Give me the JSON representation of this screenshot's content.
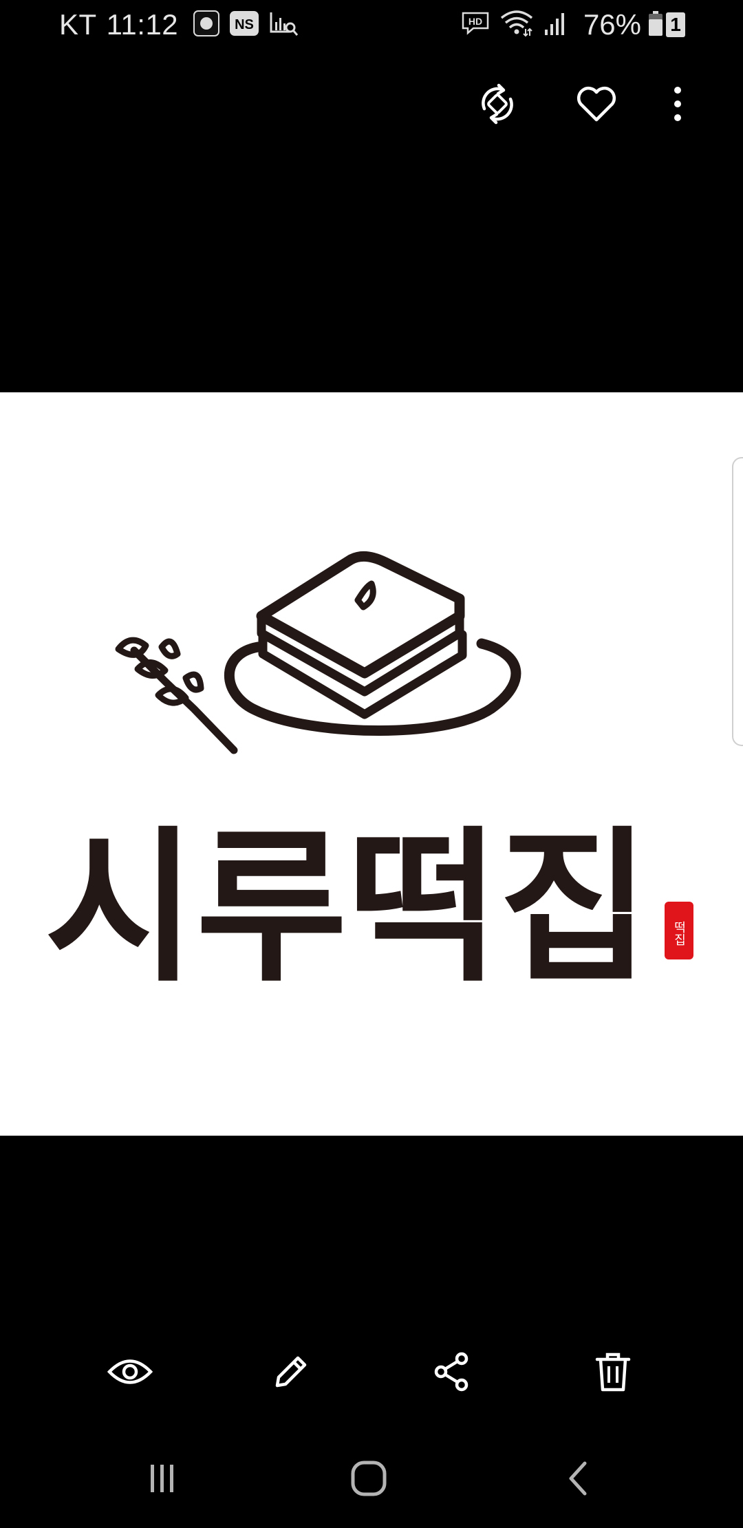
{
  "status_bar": {
    "carrier": "KT",
    "time": "11:12",
    "left_icons": [
      "record-icon",
      "ns-icon",
      "data-usage-icon"
    ],
    "right_icons": [
      "hd-voice-icon",
      "wifi-icon",
      "signal-icon"
    ],
    "battery_percent": "76%",
    "sim_slot": "1"
  },
  "top_actions": {
    "icons": [
      "rotate-icon",
      "heart-icon",
      "more-options-icon"
    ]
  },
  "photo": {
    "logo_text": "시루떡집",
    "seal_text": "떡집",
    "background": "#ffffff",
    "ink_color": "#231815",
    "seal_color": "#e0141b"
  },
  "bottom_toolbar": {
    "icons": [
      "view-icon",
      "edit-icon",
      "share-icon",
      "delete-icon"
    ]
  },
  "nav_bar": {
    "icons": [
      "recent-apps-icon",
      "home-icon",
      "back-icon"
    ]
  },
  "colors": {
    "background": "#000000",
    "icon": "#ffffff",
    "nav_icon": "#b4b4b4"
  }
}
